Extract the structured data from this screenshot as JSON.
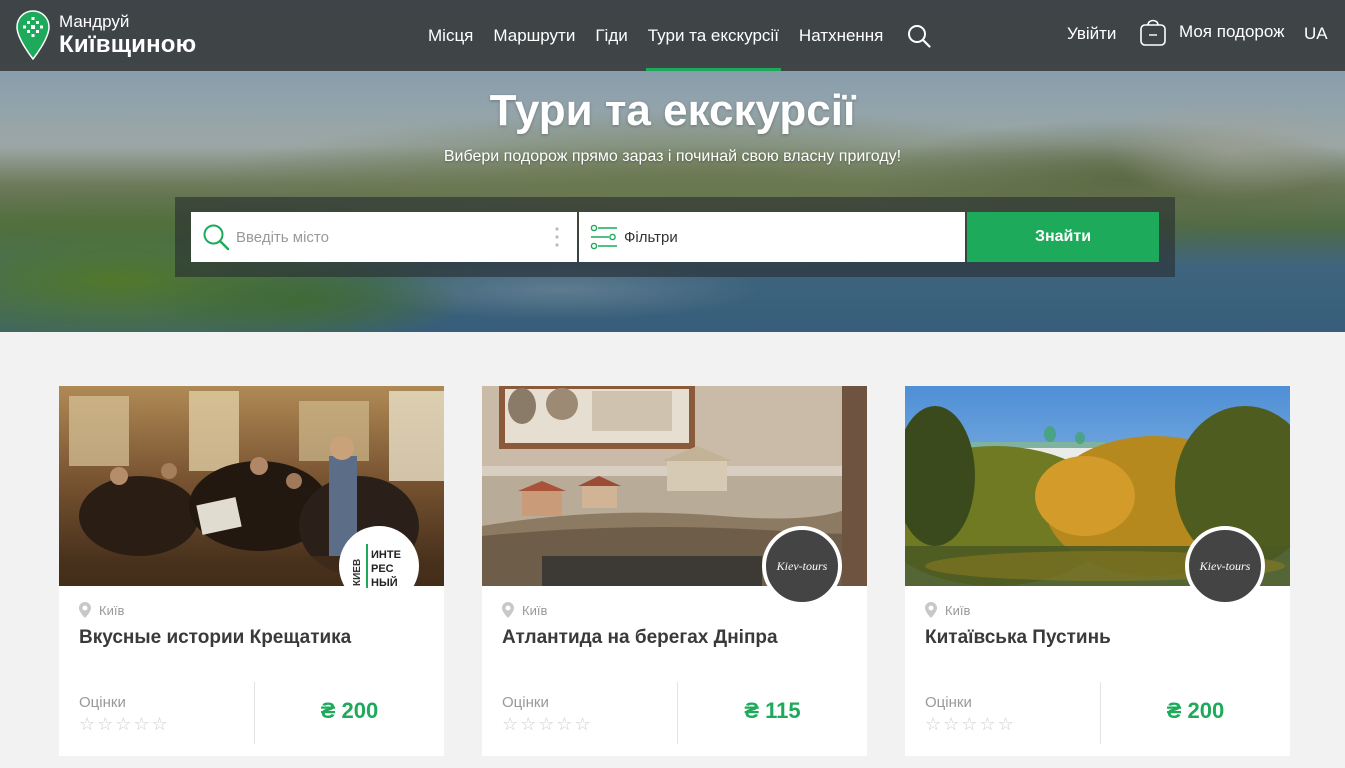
{
  "brand": {
    "line1": "Мандруй",
    "line2": "Київщиною",
    "accent_color": "#1daa5a",
    "header_bg": "#3a3e40"
  },
  "nav": {
    "items": [
      {
        "label": "Місця",
        "active": false
      },
      {
        "label": "Маршрути",
        "active": false
      },
      {
        "label": "Гіди",
        "active": false
      },
      {
        "label": "Тури та екскурсії",
        "active": true
      },
      {
        "label": "Натхнення",
        "active": false
      }
    ],
    "search_icon": "search-icon"
  },
  "header_right": {
    "login": "Увійти",
    "trip": "Моя подорож",
    "trip_icon": "bag-icon",
    "lang": "UA"
  },
  "hero": {
    "title": "Тури та екскурсії",
    "subtitle": "Вибери подорож прямо зараз і починай свою власну пригоду!"
  },
  "search": {
    "city_placeholder": "Введіть місто",
    "city_value": "",
    "filters_label": "Фільтри",
    "submit_label": "Знайти"
  },
  "cards": [
    {
      "location": "Київ",
      "title": "Вкусные истории Крещатика",
      "rating_label": "Оцінки",
      "rating": 0,
      "stars": "☆☆☆☆☆",
      "price": "₴ 200",
      "badge": {
        "type": "logo",
        "lines": [
          "ИНТЕ",
          "РЕС",
          "НЫЙ"
        ],
        "side": "КИЕВ"
      }
    },
    {
      "location": "Київ",
      "title": "Атлантида на берегах Дніпра",
      "rating_label": "Оцінки",
      "rating": 0,
      "stars": "☆☆☆☆☆",
      "price": "₴ 115",
      "badge": {
        "type": "logo",
        "text": "Kiev-tours"
      }
    },
    {
      "location": "Київ",
      "title": "Китаївська Пустинь",
      "rating_label": "Оцінки",
      "rating": 0,
      "stars": "☆☆☆☆☆",
      "price": "₴ 200",
      "badge": {
        "type": "logo",
        "text": "Kiev-tours"
      }
    }
  ]
}
